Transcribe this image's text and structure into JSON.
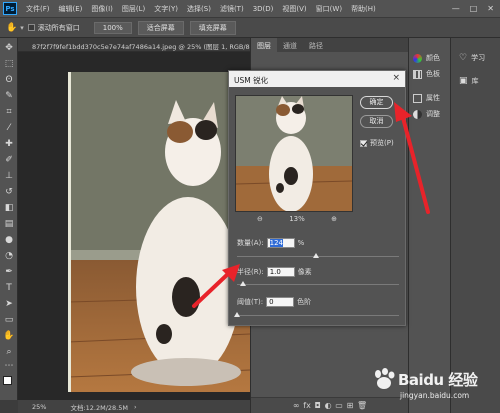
{
  "app": {
    "logo": "Ps"
  },
  "menu": [
    "文件(F)",
    "编辑(E)",
    "图像(I)",
    "图层(L)",
    "文字(Y)",
    "选择(S)",
    "滤镜(T)",
    "3D(D)",
    "视图(V)",
    "窗口(W)",
    "帮助(H)"
  ],
  "window_controls": {
    "minimize": "—",
    "maximize": "□",
    "close": "✕"
  },
  "options_bar": {
    "scroll_all_label": "滚动所有窗口",
    "zoom_value": "100%",
    "fit_screen": "适合屏幕",
    "fill_screen": "填充屏幕"
  },
  "document": {
    "tab_title": "87f2f7f9fef1bdd370c5e7e74af7486a14.jpeg @ 25% (图层 1, RGB/8#) *",
    "status_zoom": "25%",
    "status_doc": "文档:12.2M/28.5M"
  },
  "layers_panel": {
    "tabs": [
      "图层",
      "通道",
      "路径"
    ],
    "bottom_icons": [
      "link-icon",
      "fx-icon",
      "mask-icon",
      "adjustment-icon",
      "folder-icon",
      "new-layer-icon",
      "trash-icon"
    ]
  },
  "dock1": [
    {
      "label": "颜色",
      "icon": "color-icon"
    },
    {
      "label": "色板",
      "icon": "swatches-icon"
    },
    {
      "label": "属性",
      "icon": "properties-icon"
    },
    {
      "label": "调整",
      "icon": "adjustments-icon"
    }
  ],
  "dock2": [
    {
      "label": "学习",
      "icon": "lightbulb-icon"
    },
    {
      "label": "库",
      "icon": "libraries-icon"
    }
  ],
  "dialog": {
    "title": "USM 锐化",
    "close": "×",
    "ok_label": "确定",
    "cancel_label": "取消",
    "preview_label": "预览(P)",
    "preview_checked": true,
    "zoom_percent": "13%",
    "amount": {
      "label": "数量(A):",
      "value": "124",
      "unit": "%",
      "slider_fraction": 0.49
    },
    "radius": {
      "label": "半径(R):",
      "value": "1.0",
      "unit": "像素",
      "slider_fraction": 0.04
    },
    "threshold": {
      "label": "阈值(T):",
      "value": "0",
      "unit": "色阶",
      "slider_fraction": 0.0
    }
  },
  "annotation_color": "#e8232a",
  "watermark": {
    "brand": "Baidu 经验",
    "url": "jingyan.baidu.com"
  }
}
